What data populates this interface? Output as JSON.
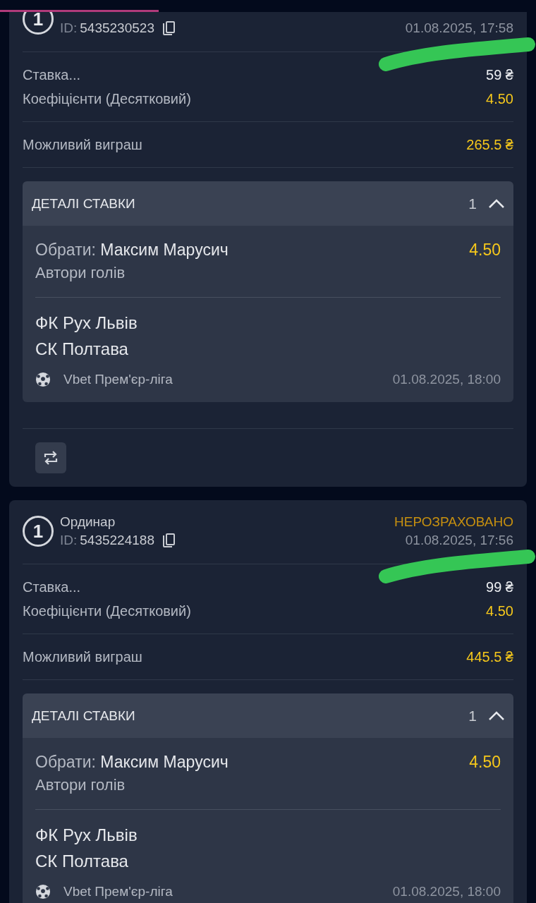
{
  "progress_bar": {
    "level": 0.296
  },
  "bets": [
    {
      "count": "1",
      "id_label": "ID:",
      "id": "5435230523",
      "date": "01.08.2025, 17:58",
      "stake_label": "Ставка...",
      "stake": "59 ₴",
      "odds_label": "Коефіцієнти (Десятковий)",
      "odds": "4.50",
      "win_label": "Можливий виграш",
      "win": "265.5 ₴",
      "details": {
        "title": "ДЕТАЛІ СТАВКИ",
        "count": "1",
        "expanded": true,
        "selections": [
          {
            "pick_label": "Обрати:",
            "pick": "Максим Марусич",
            "market": "Автори голів",
            "odds": "4.50",
            "home": "ФК Рух Львів",
            "away": "СК Полтава",
            "league": "Vbet Прем'єр-ліга",
            "date": "01.08.2025, 18:00"
          }
        ]
      },
      "repeat_button": true
    },
    {
      "type": "Ординар",
      "count": "1",
      "id_label": "ID:",
      "id": "5435224188",
      "status": "НЕРОЗРАХОВАНО",
      "date": "01.08.2025, 17:56",
      "stake_label": "Ставка...",
      "stake": "99 ₴",
      "odds_label": "Коефіцієнти (Десятковий)",
      "odds": "4.50",
      "win_label": "Можливий виграш",
      "win": "445.5 ₴",
      "details": {
        "title": "ДЕТАЛІ СТАВКИ",
        "count": "1",
        "expanded": true,
        "selections": [
          {
            "pick_label": "Обрати:",
            "pick": "Максим Марусич",
            "market": "Автори голів",
            "odds": "4.50",
            "home": "ФК Рух Львів",
            "away": "СК Полтава",
            "league": "Vbet Прем'єр-ліга",
            "date": "01.08.2025, 18:00"
          }
        ]
      }
    }
  ]
}
